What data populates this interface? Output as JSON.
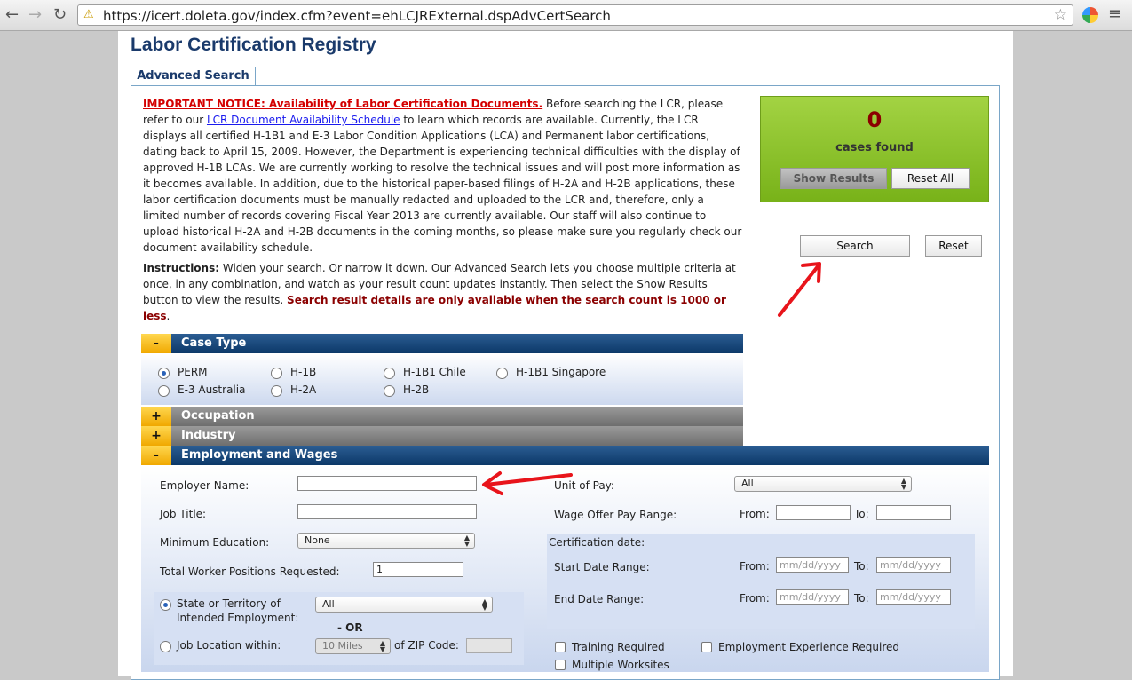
{
  "browser": {
    "url": "https://icert.doleta.gov/index.cfm?event=ehLCJRExternal.dspAdvCertSearch"
  },
  "page": {
    "title": "Labor Certification Registry",
    "tab": "Advanced Search"
  },
  "notice": {
    "heading": "IMPORTANT NOTICE: Availability of Labor Certification Documents.",
    "text_before_link": " Before searching the LCR, please refer to our ",
    "link": "LCR Document Availability Schedule",
    "text_after_link": " to learn which records are available. Currently, the LCR displays all certified H-1B1 and E-3 Labor Condition Applications (LCA) and Permanent labor certifications, dating back to April 15, 2009. However, the Department is experiencing technical difficulties with the display of approved H-1B LCAs. We are currently working to resolve the technical issues and will post more information as it becomes available. In addition, due to the historical paper-based filings of H-2A and H-2B applications, these labor certification documents must be manually redacted and uploaded to the LCR and, therefore, only a limited number of records covering Fiscal Year 2013 are currently available. Our staff will also continue to upload historical H-2A and H-2B documents in the coming months, so please make sure you regularly check our document availability schedule."
  },
  "instructions": {
    "label": "Instructions:",
    "text": " Widen your search. Or narrow it down. Our Advanced Search lets you choose multiple criteria at once, in any combination, and watch as your result count updates instantly. Then select the Show Results button to view the results. ",
    "warning": "Search result details are only available when the search count is 1000 or less",
    "period": "."
  },
  "results": {
    "count": "0",
    "label": "cases found",
    "show_results": "Show Results",
    "reset_all": "Reset All",
    "search": "Search",
    "reset": "Reset"
  },
  "sections": {
    "case_type": {
      "toggle": "-",
      "label": "Case Type"
    },
    "occupation": {
      "toggle": "+",
      "label": "Occupation"
    },
    "industry": {
      "toggle": "+",
      "label": "Industry"
    },
    "employment": {
      "toggle": "-",
      "label": "Employment and Wages"
    }
  },
  "case_types": [
    "PERM",
    "H-1B",
    "H-1B1 Chile",
    "H-1B1 Singapore",
    "E-3 Australia",
    "H-2A",
    "H-2B"
  ],
  "case_type_selected": "PERM",
  "employment": {
    "employer_name_label": "Employer Name:",
    "job_title_label": "Job Title:",
    "min_education_label": "Minimum Education:",
    "min_education_value": "None",
    "total_workers_label": "Total Worker Positions Requested:",
    "total_workers_value": "1",
    "state_label_1": "State or Territory of",
    "state_label_2": "Intended Employment:",
    "state_value": "All",
    "or_label": "- OR",
    "job_location_label": "Job Location within:",
    "miles_value": "10 Miles",
    "zip_label": "of ZIP Code:",
    "unit_of_pay_label": "Unit of Pay:",
    "unit_of_pay_value": "All",
    "wage_range_label": "Wage Offer Pay Range:",
    "from_label": "From:",
    "to_label": "To:",
    "cert_date_label": "Certification date:",
    "start_date_label": "Start Date Range:",
    "end_date_label": "End Date Range:",
    "date_placeholder": "mm/dd/yyyy",
    "training_required": "Training Required",
    "experience_required": "Employment Experience Required",
    "multiple_worksites": "Multiple Worksites"
  },
  "colors": {
    "title": "#1a3a6b",
    "section_bar": "#0c3868",
    "toggle": "#f0a800",
    "results_box": "#8cc22e",
    "warning": "#8b0000",
    "notice": "#d40000",
    "annotation_arrow": "#e8141b"
  }
}
